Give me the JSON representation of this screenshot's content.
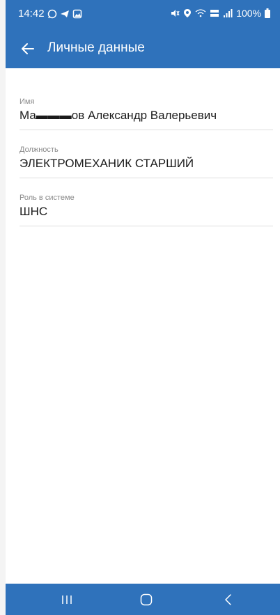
{
  "status_bar": {
    "time": "14:42",
    "battery": "100%"
  },
  "app_bar": {
    "title": "Личные данные",
    "back_icon": "arrow-left-icon"
  },
  "fields": [
    {
      "label": "Имя",
      "value": "Ма▬▬▬ов Александр Валерьевич"
    },
    {
      "label": "Должность",
      "value": "ЭЛЕКТРОМЕХАНИК СТАРШИЙ"
    },
    {
      "label": "Роль в системе",
      "value": "ШНС"
    }
  ],
  "nav_bar": {
    "recent_icon": "recent-apps-icon",
    "home_icon": "home-icon",
    "back_icon": "back-icon"
  },
  "colors": {
    "primary": "#2f72bb",
    "divider": "#dddddd",
    "label": "#8a8a8a",
    "value": "#1b1b1b"
  }
}
